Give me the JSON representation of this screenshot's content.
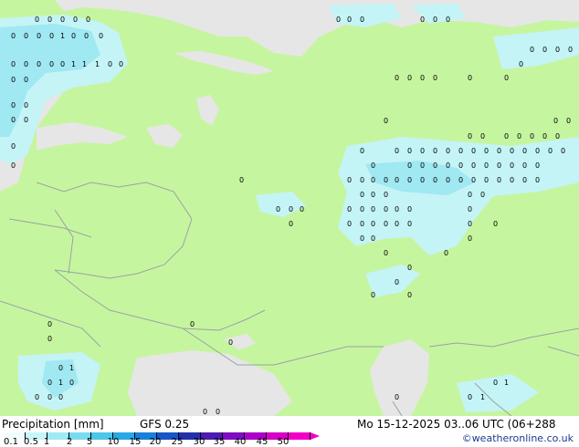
{
  "footer": {
    "title": "Precipitation [mm]",
    "model": "GFS 0.25",
    "valid_time": "Mo 15-12-2025 03..06 UTC (06+288",
    "credit": "©weatheronline.co.uk"
  },
  "legend": {
    "ticks": [
      "0.1",
      "0.5",
      "1",
      "2",
      "5",
      "10",
      "15",
      "20",
      "25",
      "30",
      "35",
      "40",
      "45",
      "50"
    ],
    "colors": [
      "#f0fdfd",
      "#c6f6f8",
      "#a0eaf3",
      "#77dcf0",
      "#4cc6ea",
      "#2aa8e4",
      "#1880d8",
      "#1a55c6",
      "#2430a8",
      "#4c1cae",
      "#7e0cc0",
      "#ad00c8",
      "#d600c6",
      "#f200c8"
    ]
  },
  "map": {
    "land_color": "#c6f5a0",
    "sea_color": "#e6e6e6",
    "precip_light": "#c4f4f6",
    "precip_medium": "#a0e8f2",
    "border_color": "#9aa3a0",
    "labels": [
      "0",
      "1",
      "0",
      "0",
      "1",
      "0"
    ]
  }
}
